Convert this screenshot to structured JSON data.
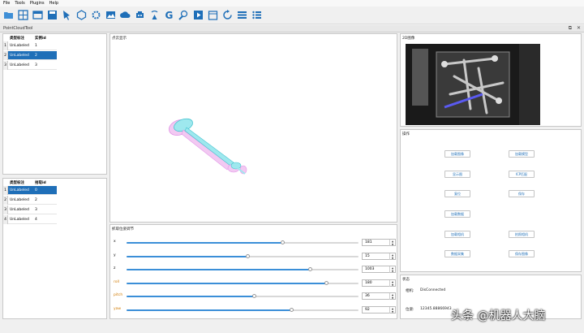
{
  "menu": [
    "File",
    "Tools",
    "Plugins",
    "Help"
  ],
  "toolbar_icons": [
    "open-folder-icon",
    "grid-icon",
    "folder-icon",
    "save-icon",
    "pointer-icon",
    "cube-icon",
    "settings-icon",
    "image-icon",
    "cloud-icon",
    "robot-icon",
    "antenna-icon",
    "g-icon",
    "brush-icon",
    "play-icon",
    "calendar-icon",
    "refresh-icon",
    "list-icon",
    "menu-icon"
  ],
  "doc_tab": "PointCloudTool",
  "doc_ctrls": [
    "⧉",
    "✕"
  ],
  "top_table": {
    "headers": [
      "类型标注",
      "实例id"
    ],
    "rows": [
      {
        "num": "1",
        "label": "UnLabeled",
        "id": "1",
        "selected": false
      },
      {
        "num": "2",
        "label": "UnLabeled",
        "id": "2",
        "selected": true
      },
      {
        "num": "3",
        "label": "UnLabeled",
        "id": "3",
        "selected": false
      }
    ]
  },
  "bottom_table": {
    "headers": [
      "类型标注",
      "拾取id"
    ],
    "rows": [
      {
        "num": "1",
        "label": "UnLabeled",
        "id": "0",
        "selected": true
      },
      {
        "num": "2",
        "label": "UnLabeled",
        "id": "2",
        "selected": false
      },
      {
        "num": "3",
        "label": "UnLabeled",
        "id": "3",
        "selected": false
      },
      {
        "num": "4",
        "label": "UnLabeled",
        "id": "4",
        "selected": false
      }
    ]
  },
  "view3d_title": "点云显示",
  "image_title": "2D图像",
  "ops_title": "操作",
  "buttons": [
    "加载图像",
    "加载模型",
    "显示图",
    "ICP匹配",
    "复位",
    "保存",
    "加载数据",
    "加载相机",
    "拍照相机",
    "数据采集",
    "保存图像"
  ],
  "pose_title": "抓取位姿调节",
  "sliders": [
    {
      "label": "x",
      "value": "181",
      "ratio": 0.67
    },
    {
      "label": "y",
      "value": "15",
      "ratio": 0.52
    },
    {
      "label": "z",
      "value": "1003",
      "ratio": 0.79
    },
    {
      "label": "roll",
      "value": "180",
      "ratio": 0.86
    },
    {
      "label": "pitch",
      "value": "36",
      "ratio": 0.55
    },
    {
      "label": "yaw",
      "value": "92",
      "ratio": 0.71
    }
  ],
  "status_title": "状态",
  "status": {
    "camera_label": "相机:",
    "camera_value": "DisConnected",
    "pose_label": "位姿:",
    "pose_value": "12345.88866943"
  },
  "watermark": "头条 @机器人大脑"
}
